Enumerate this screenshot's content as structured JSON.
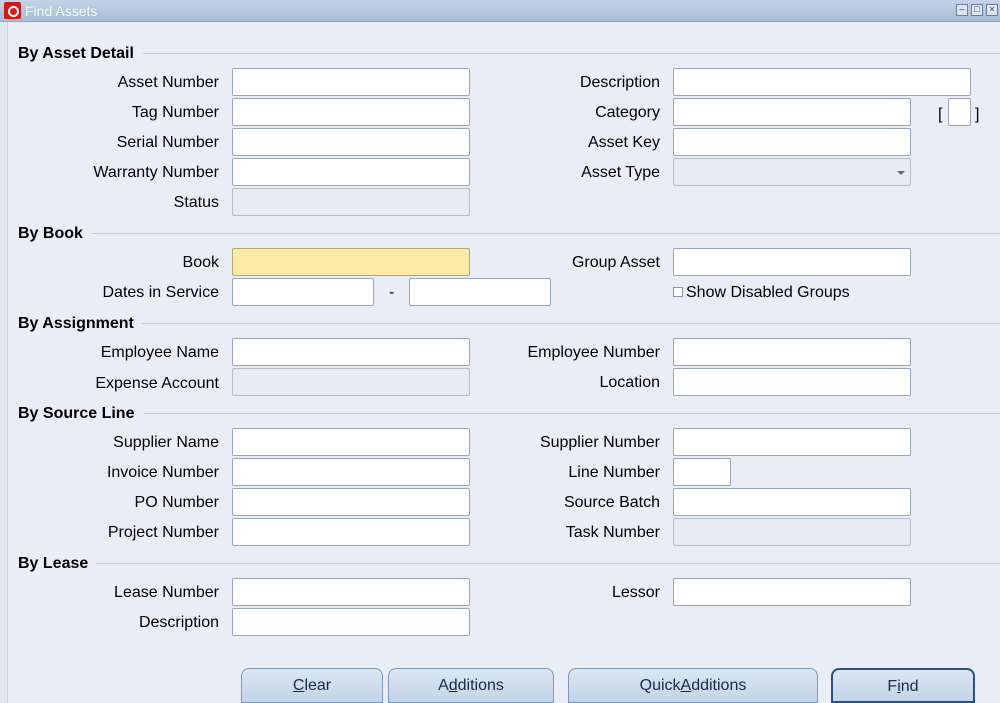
{
  "window": {
    "title": "Find Assets"
  },
  "sections": {
    "asset_detail": "By Asset Detail",
    "book": "By Book",
    "assignment": "By Assignment",
    "source_line": "By Source Line",
    "lease": "By Lease"
  },
  "labels": {
    "asset_number": "Asset Number",
    "tag_number": "Tag Number",
    "serial_number": "Serial Number",
    "warranty_number": "Warranty Number",
    "status": "Status",
    "description": "Description",
    "category": "Category",
    "asset_key": "Asset Key",
    "asset_type": "Asset Type",
    "book": "Book",
    "dates_in_service": "Dates in Service",
    "dates_separator": "-",
    "group_asset": "Group Asset",
    "show_disabled_groups": "Show Disabled Groups",
    "employee_name": "Employee Name",
    "expense_account": "Expense Account",
    "employee_number": "Employee Number",
    "location": "Location",
    "supplier_name": "Supplier Name",
    "invoice_number": "Invoice Number",
    "po_number": "PO Number",
    "project_number": "Project Number",
    "supplier_number": "Supplier Number",
    "line_number": "Line Number",
    "source_batch": "Source Batch",
    "task_number": "Task Number",
    "lease_number": "Lease Number",
    "lease_description": "Description",
    "lessor": "Lessor",
    "bracket_open": "[",
    "bracket_close": "]"
  },
  "buttons": {
    "clear_pre": "",
    "clear_mn": "C",
    "clear_post": "lear",
    "additions_pre": "A",
    "additions_mn": "d",
    "additions_post": "ditions",
    "quick_pre": "Quick",
    "quick_mn": "A",
    "quick_post": "dditions",
    "find_pre": "F",
    "find_mn": "i",
    "find_post": "nd"
  }
}
